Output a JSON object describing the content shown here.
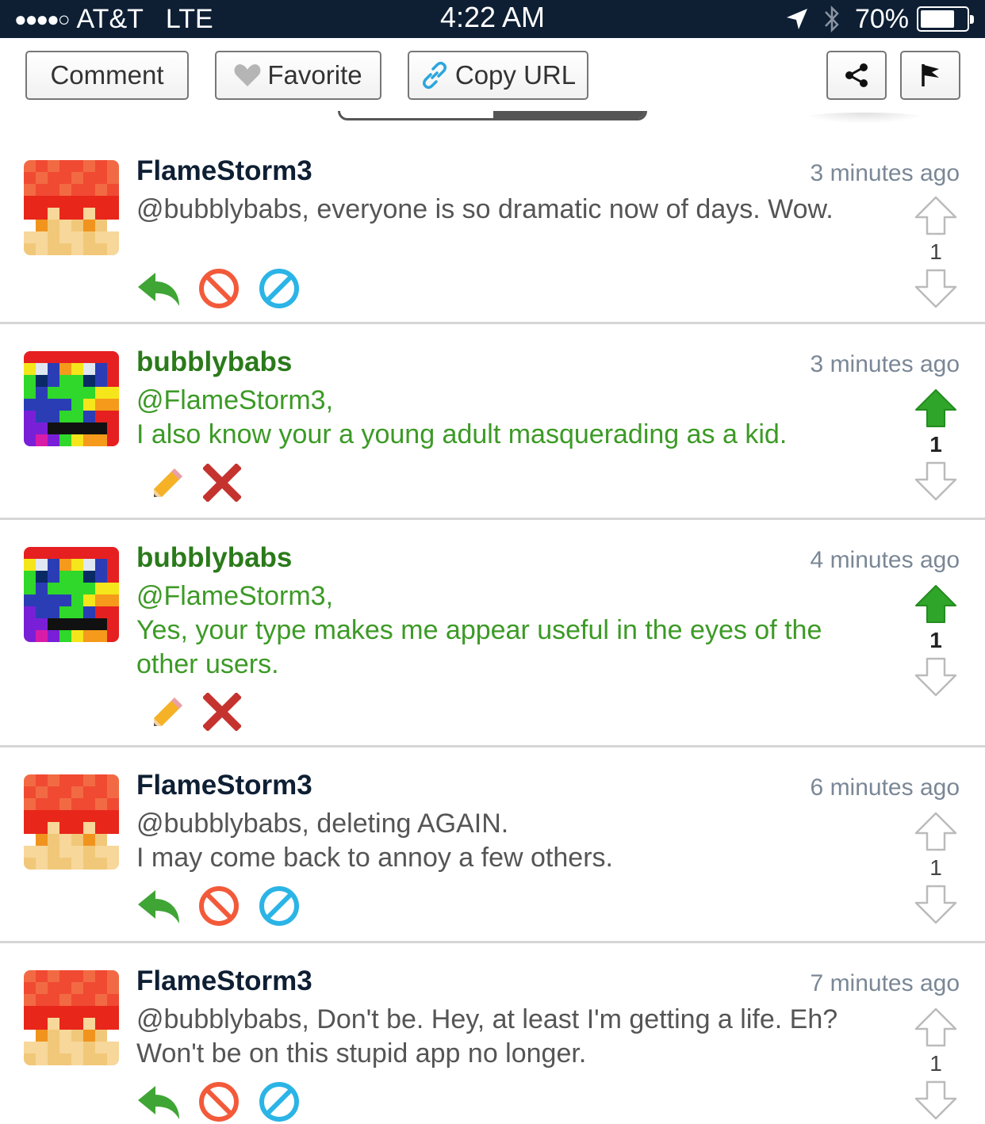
{
  "status_bar": {
    "signal": "●●●●○",
    "carrier": "AT&T",
    "network": "LTE",
    "time": "4:22 AM",
    "battery": "70%"
  },
  "toolbar": {
    "comment_label": "Comment",
    "favorite_label": "Favorite",
    "copy_url_label": "Copy URL"
  },
  "colors": {
    "status_bar_bg": "#0e1f34",
    "reply_green": "#3fa535",
    "block_red": "#f25a3a",
    "mute_blue": "#2bb4e6",
    "upvote_green": "#2fa52a",
    "delete_red": "#c5332f"
  },
  "comments": [
    {
      "username": "FlameStorm3",
      "time": "3 minutes ago",
      "lines": [
        "@bubblybabs, everyone is so dramatic now of days. Wow."
      ],
      "votes": "1",
      "upvoted": false,
      "icons": [
        "reply-arrow-icon",
        "block-icon",
        "mute-icon",
        "upvote-arrow-icon",
        "downvote-arrow-icon"
      ]
    },
    {
      "username": "bubblybabs",
      "time": "3 minutes ago",
      "lines": [
        "@FlameStorm3,",
        "I also know your a young adult masquerading as a kid."
      ],
      "votes": "1",
      "upvoted": true,
      "icons": [
        "pencil-icon",
        "delete-x-icon",
        "upvote-arrow-icon",
        "downvote-arrow-icon"
      ]
    },
    {
      "username": "bubblybabs",
      "time": "4 minutes ago",
      "lines": [
        "@FlameStorm3,",
        "Yes, your type makes me appear useful in the eyes of the",
        "other users."
      ],
      "votes": "1",
      "upvoted": true,
      "icons": [
        "pencil-icon",
        "delete-x-icon",
        "upvote-arrow-icon",
        "downvote-arrow-icon"
      ]
    },
    {
      "username": "FlameStorm3",
      "time": "6 minutes ago",
      "lines": [
        "@bubblybabs, deleting AGAIN.",
        "I may come back to annoy a few others."
      ],
      "votes": "1",
      "upvoted": false,
      "icons": [
        "reply-arrow-icon",
        "block-icon",
        "mute-icon",
        "upvote-arrow-icon",
        "downvote-arrow-icon"
      ]
    },
    {
      "username": "FlameStorm3",
      "time": "7 minutes ago",
      "lines": [
        "@bubblybabs, Don't be. Hey, at least I'm getting a life. Eh?",
        "Won't be on this stupid app no longer."
      ],
      "votes": "1",
      "upvoted": false,
      "icons": [
        "reply-arrow-icon",
        "block-icon",
        "mute-icon",
        "upvote-arrow-icon",
        "downvote-arrow-icon"
      ]
    }
  ]
}
